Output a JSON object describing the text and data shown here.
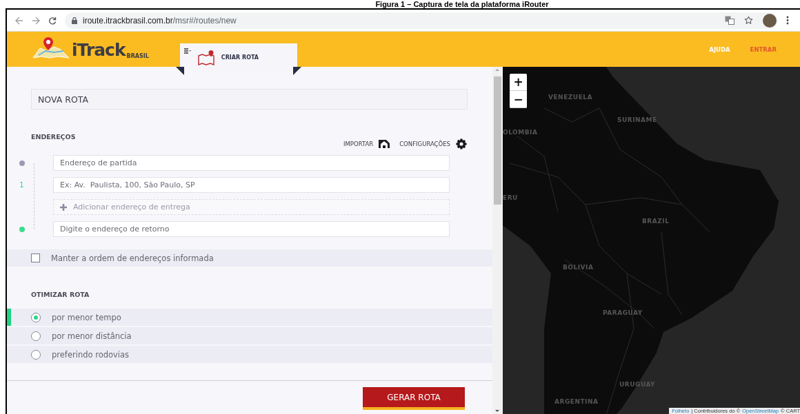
{
  "caption": "Figura 1 – Captura de tela da plataforma iRouter",
  "browser": {
    "url_host": "iroute.itrackbrasil.com.br",
    "url_path": "/msr#/routes/new"
  },
  "header": {
    "logo": "iTrack",
    "logo_sub": "BRASIL",
    "tab": {
      "label": "CRIAR ROTA",
      "selected": true
    },
    "links": [
      {
        "label": "AJUDA",
        "kind": "plain"
      },
      {
        "label": "ENTRAR",
        "kind": "accent"
      }
    ]
  },
  "form": {
    "route_name": "NOVA ROTA",
    "addresses_title": "ENDEREÇOS",
    "actions": [
      {
        "label": "IMPORTAR",
        "kind": "import"
      },
      {
        "label": "CONFIGURAÇÕES",
        "kind": "settings"
      }
    ],
    "stops": [
      {
        "kind": "start",
        "placeholder": "Endereço de partida"
      },
      {
        "kind": "delivery",
        "number": "1",
        "placeholder": "Ex: Av.  Paulista, 100, São Paulo, SP"
      },
      {
        "kind": "add",
        "label": "Adicionar endereço de entrega"
      },
      {
        "kind": "return",
        "placeholder": "Digite o endereço de retorno"
      }
    ],
    "keep_order": {
      "label": "Manter a ordem de endereços informada",
      "checked": false
    },
    "optimize_title": "OTIMIZAR ROTA",
    "options": [
      {
        "label": "por menor tempo",
        "selected": true
      },
      {
        "label": "por menor distância",
        "selected": false
      },
      {
        "label": "preferindo rodovias",
        "selected": false
      }
    ],
    "submit": "GERAR ROTA"
  },
  "map": {
    "zoom_in": "+",
    "zoom_out": "−",
    "labels": [
      "VENEZUELA",
      "SURINAME",
      "OLOMBIA",
      "ERU",
      "BRAZIL",
      "BOLIVIA",
      "PARAGUAY",
      "URUGUAY",
      "ARGENTINA"
    ],
    "attribution": [
      {
        "text": "Folheto",
        "link": true
      },
      {
        "text": "| Contribuidores do ©",
        "link": false
      },
      {
        "text": "OpenStreetMap",
        "link": true
      },
      {
        "text": "© CART",
        "link": false
      }
    ]
  }
}
